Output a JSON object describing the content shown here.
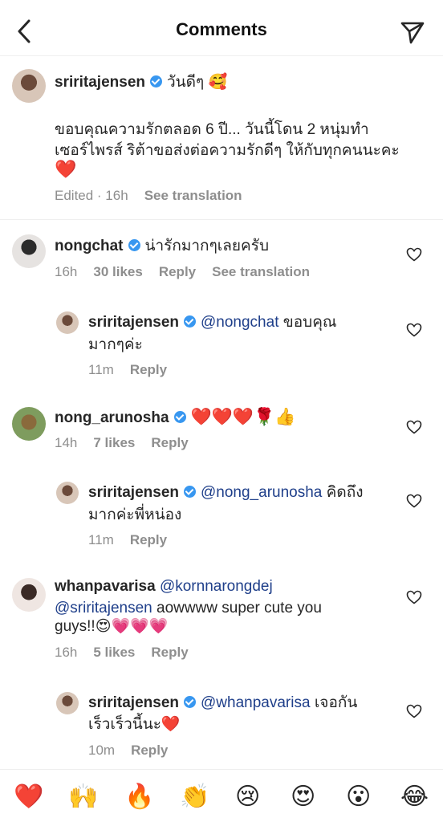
{
  "header": {
    "title": "Comments"
  },
  "caption": {
    "username": "sriritajensen",
    "text_first": "วันดีๆ 🥰",
    "line2": "ขอบคุณความรักตลอด 6 ปี... วันนี้โดน 2 หนุ่มทำ",
    "line3": "เซอร์ไพรส์ ริต้าขอส่งต่อความรักดีๆ ให้กับทุกคนนะคะ",
    "line4": "❤️",
    "edited": "Edited · 16h",
    "see_translation": "See translation"
  },
  "comments": [
    {
      "username": "nongchat",
      "text": "น่ารักมากๆเลยครับ",
      "time": "16h",
      "likes": "30 likes",
      "reply": "Reply",
      "see_translation": "See translation"
    },
    {
      "username": "sriritajensen",
      "mention": "@nongchat",
      "text_rest": "ขอบคุณ",
      "line2": "มากๆค่ะ",
      "time": "11m",
      "reply": "Reply"
    },
    {
      "username": "nong_arunosha",
      "text": "❤️❤️❤️🌹👍",
      "time": "14h",
      "likes": "7 likes",
      "reply": "Reply"
    },
    {
      "username": "sriritajensen",
      "mention": "@nong_arunosha",
      "text_rest": "คิดถึง",
      "line2": "มากค่ะพี่หน่อง",
      "time": "11m",
      "reply": "Reply"
    },
    {
      "username": "whanpavarisa",
      "mention": "@kornnarongdej",
      "line2_mention": "@sriritajensen",
      "line2_text": "aowwww super cute you",
      "line3": "guys!!😍💗💗💗",
      "time": "16h",
      "likes": "5 likes",
      "reply": "Reply"
    },
    {
      "username": "sriritajensen",
      "mention": "@whanpavarisa",
      "text_rest": "เจอกัน",
      "line2": "เร็วเร็วนี้นะ❤️",
      "time": "10m",
      "reply": "Reply"
    }
  ],
  "emoji_bar": [
    "❤️",
    "🙌",
    "🔥",
    "👏",
    "😢",
    "😍",
    "😮",
    "😂"
  ]
}
